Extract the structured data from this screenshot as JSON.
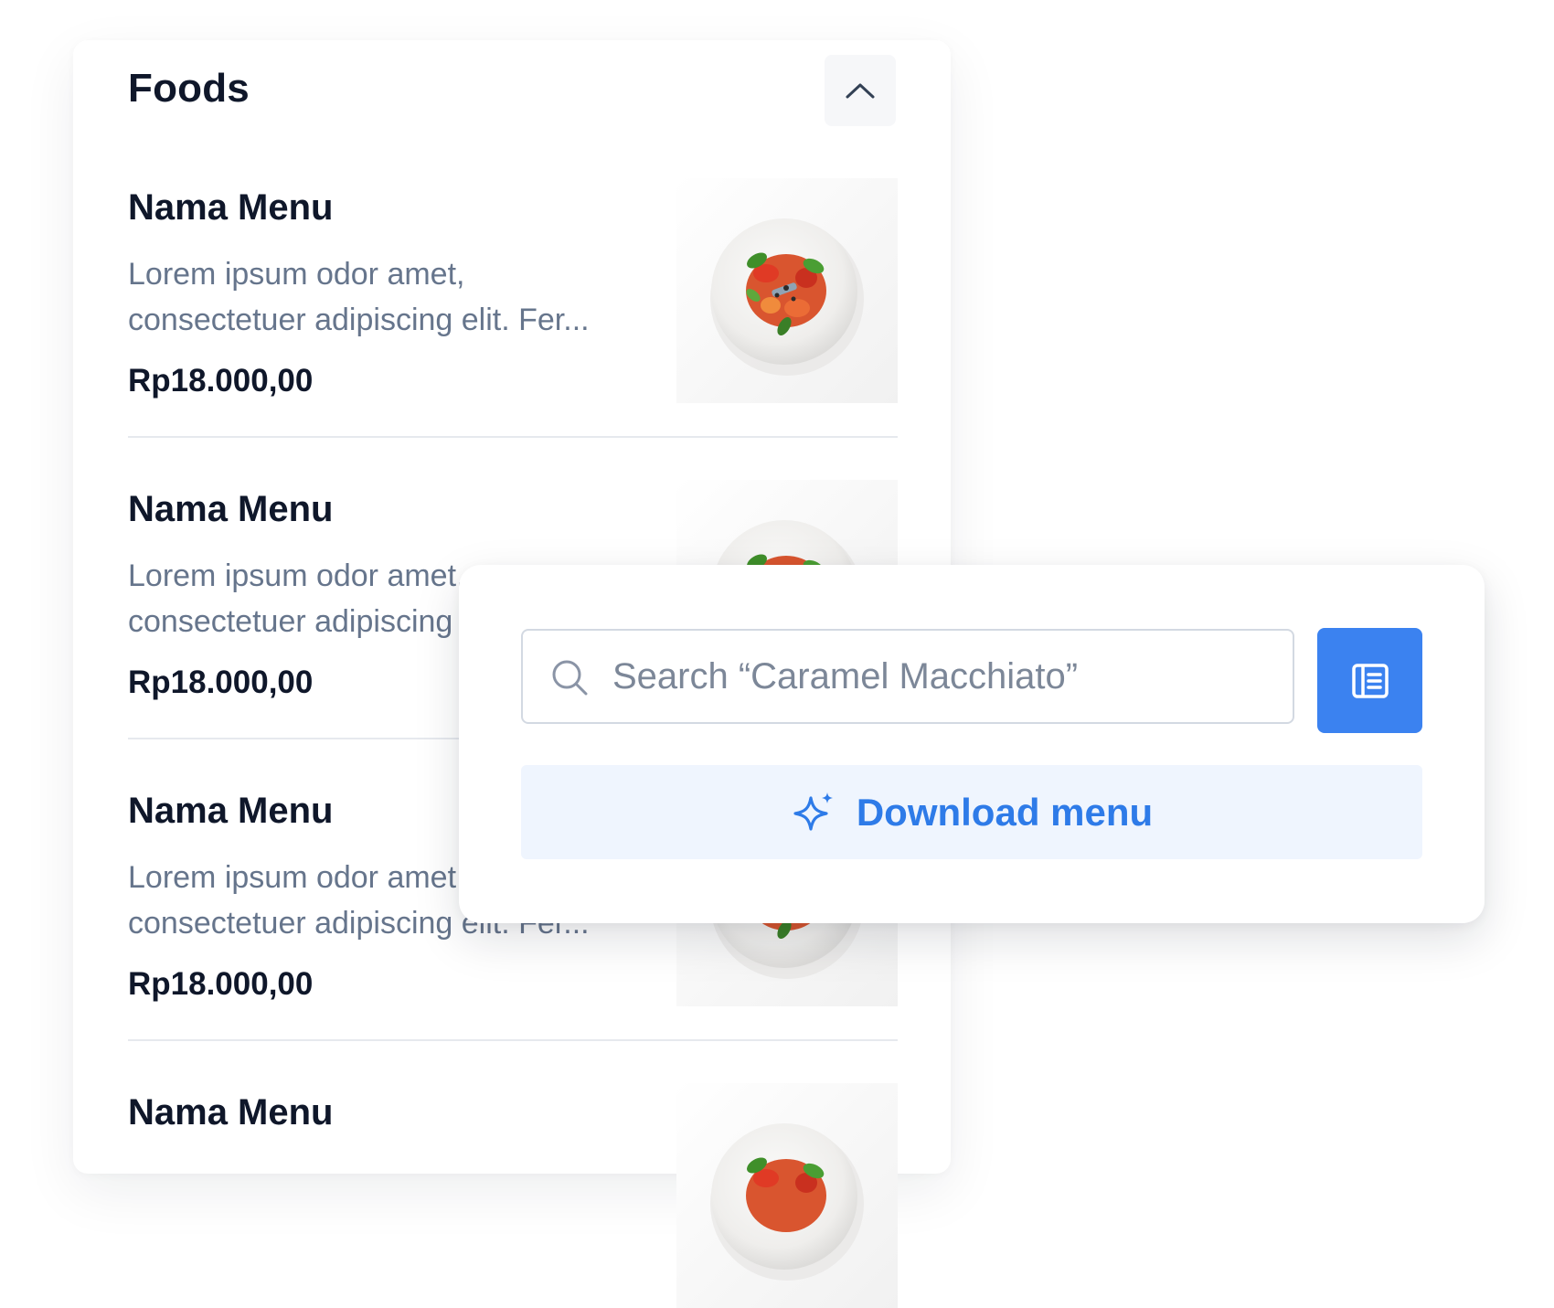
{
  "section": {
    "title": "Foods",
    "collapse_icon": "chevron-up-icon"
  },
  "menu_items": [
    {
      "name": "Nama Menu",
      "desc_line1": "Lorem ipsum odor amet,",
      "desc_line2": "consectetuer adipiscing elit. Fer...",
      "price": "Rp18.000,00"
    },
    {
      "name": "Nama Menu",
      "desc_line1": "Lorem ipsum odor amet,",
      "desc_line2": "consectetuer adipiscing elit. Fer...",
      "price": "Rp18.000,00"
    },
    {
      "name": "Nama Menu",
      "desc_line1": "Lorem ipsum odor amet,",
      "desc_line2": "consectetuer adipiscing elit. Fer...",
      "price": "Rp18.000,00"
    },
    {
      "name": "Nama Menu"
    }
  ],
  "search": {
    "placeholder": "Search “Caramel Macchiato”",
    "icon": "search-icon"
  },
  "menu_book_button": {
    "icon": "menu-book-icon"
  },
  "download": {
    "label": "Download menu",
    "icon": "sparkle-icon"
  },
  "colors": {
    "primary": "#3b82f0",
    "primary_light": "#eff5fe",
    "heading": "#0f172a",
    "muted": "#66758c"
  }
}
